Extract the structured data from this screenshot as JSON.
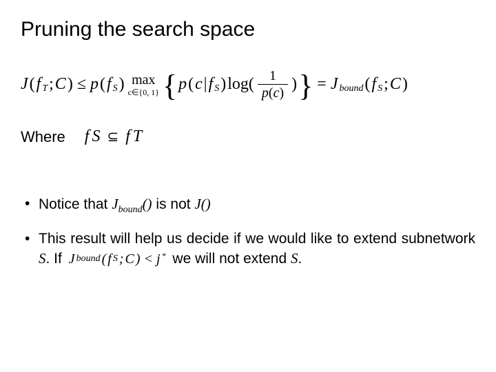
{
  "title": "Pruning the search space",
  "equation": {
    "lhs_J": "J",
    "lhs_arg_open": "(",
    "lhs_f": "f",
    "lhs_fT": "T",
    "lhs_sep": ";",
    "lhs_C": "C",
    "lhs_arg_close": ")",
    "le": "≤",
    "p": "p",
    "open": "(",
    "f": "f",
    "fS": "S",
    "close": ")",
    "max_top": "max",
    "max_bot": "c∈{0, 1}",
    "brace_l": "{",
    "pc": "p",
    "cond_open": "(",
    "c": "c",
    "bar": " | ",
    "f2": "f",
    "f2S": "S",
    "cond_close": ")",
    "log": "log(",
    "frac_num": "1",
    "frac_den_p": "p",
    "frac_den_open": "(",
    "frac_den_c": "c",
    "frac_den_close": ")",
    "log_close": ")",
    "brace_r": "}",
    "eq": "=",
    "Jb_J": "J",
    "Jb_bound": "bound",
    "Jb_open": "(",
    "Jb_f": "f",
    "Jb_fS": "S",
    "Jb_sep": ";",
    "Jb_C": "C",
    "Jb_close": ")"
  },
  "where_label": "Where",
  "where_expr": {
    "fS_f": "f",
    "fS_S": "S",
    "subset": "⊆",
    "fT_f": "f",
    "fT_T": "T"
  },
  "bullet1": {
    "pre": " Notice that ",
    "J": "J",
    "bound": "bound",
    "paren": "()",
    "mid": " is not ",
    "J2": "J()",
    "post": ""
  },
  "bullet2": {
    "line1a": "This result will help us decide if we would like to extend subnetwork ",
    "S1": "S",
    "line1b": ". If ",
    "cond_J": "J",
    "cond_bound": "bound",
    "cond_open": "(",
    "cond_f": "f",
    "cond_fS": "S",
    "cond_sep": ";",
    "cond_C": "C",
    "cond_close": ")",
    "lt": "<",
    "j": "j",
    "star": "*",
    "line2a": " we will not extend ",
    "S2": "S",
    "line2b": "."
  }
}
